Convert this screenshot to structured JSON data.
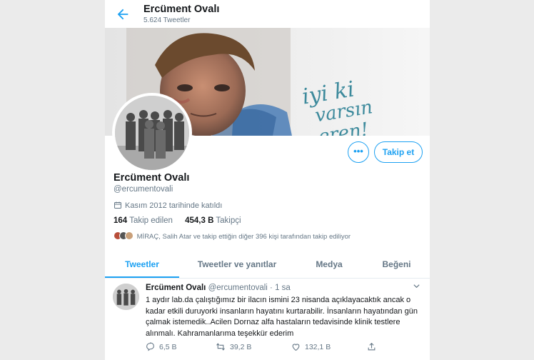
{
  "header": {
    "name": "Ercüment Ovalı",
    "tweet_count": "5.624 Tweetler"
  },
  "banner": {
    "text_line1": "iyi ki",
    "text_line2": "varsın eren!"
  },
  "profile": {
    "name": "Ercüment Ovalı",
    "handle": "@ercumentovali",
    "joined": "Kasım 2012 tarihinde katıldı",
    "following_count": "164",
    "following_label": "Takip edilen",
    "followers_count": "454,3 B",
    "followers_label": "Takipçi",
    "followed_by": "MİRAÇ, Salih Atar ve takip ettiğin diğer 396 kişi tarafından takip ediliyor"
  },
  "buttons": {
    "more": "•••",
    "follow": "Takip et"
  },
  "tabs": [
    {
      "label": "Tweetler",
      "active": true
    },
    {
      "label": "Tweetler ve yanıtlar",
      "active": false
    },
    {
      "label": "Medya",
      "active": false
    },
    {
      "label": "Beğeni",
      "active": false
    }
  ],
  "tweet": {
    "author": "Ercüment Ovalı",
    "handle": "@ercumentovali",
    "separator": "·",
    "time": "1 sa",
    "text": "1 aydır lab.da çalıştığımız bir ilacın ismini 23 nisanda açıklayacaktık ancak o kadar etkili duruyorki insanların hayatını kurtarabilir.  İnsanların hayatından gün çalmak istemedik..Acilen Dornaz alfa hastaların tedavisinde klinik testlere alınmalı. Kahramanlarıma teşekkür ederim",
    "replies": "6,5 B",
    "retweets": "39,2 B",
    "likes": "132,1 B"
  },
  "icons": {
    "back": "arrow-left-icon",
    "calendar": "calendar-icon",
    "reply": "reply-icon",
    "retweet": "retweet-icon",
    "like": "heart-icon",
    "share": "share-icon",
    "caret": "chevron-down-icon"
  },
  "colors": {
    "accent": "#1da1f2",
    "secondary_text": "#657786",
    "banner_text": "#3d8a9c"
  }
}
